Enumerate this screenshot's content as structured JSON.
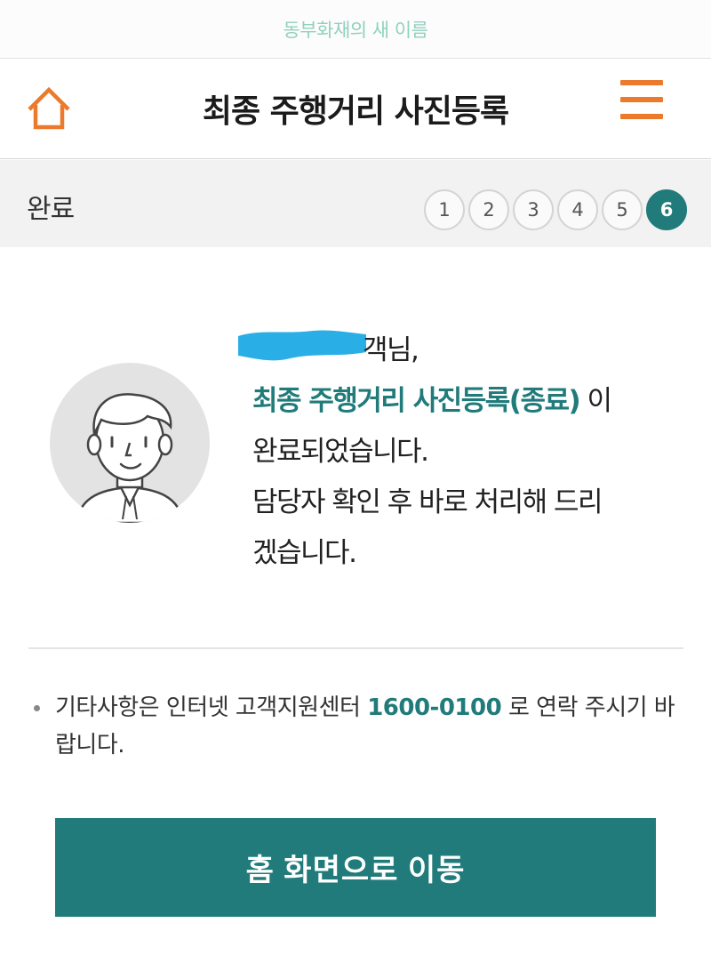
{
  "brand": {
    "note": "동부화재의 새 이름"
  },
  "header": {
    "title": "최종 주행거리 사진등록",
    "home_icon": "home-icon",
    "menu_icon": "hamburger-menu-icon"
  },
  "progress": {
    "label": "완료",
    "steps": [
      "1",
      "2",
      "3",
      "4",
      "5",
      "6"
    ],
    "current_step": 6
  },
  "message": {
    "greeting_suffix": "객님,",
    "highlight": "최종 주행거리 사진등록(종료)",
    "after_highlight": " 이",
    "line2": "완료되었습니다.",
    "line3": "담당자 확인 후 바로 처리해 드리",
    "line4": "겠습니다."
  },
  "notice": {
    "prefix": "기타사항은 인터넷 고객지원센터 ",
    "phone": "1600-0100",
    "suffix": " 로 연락 주시기 바랍니다."
  },
  "cta": {
    "label": "홈 화면으로 이동"
  },
  "colors": {
    "accent": "#207b7a",
    "brand_orange": "#ec7a2c",
    "brand_note": "#8fd1be"
  }
}
